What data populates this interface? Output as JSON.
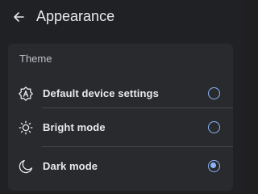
{
  "header": {
    "title": "Appearance",
    "back_icon": "arrow-left-icon"
  },
  "theme": {
    "section_label": "Theme",
    "options": [
      {
        "label": "Default device settings",
        "icon": "device-settings-icon",
        "selected": false
      },
      {
        "label": "Bright mode",
        "icon": "sun-icon",
        "selected": false
      },
      {
        "label": "Dark mode",
        "icon": "moon-icon",
        "selected": true
      }
    ]
  },
  "colors": {
    "background": "#202124",
    "panel": "#292a2d",
    "accent": "#8ab4f8",
    "text": "#e8eaed"
  }
}
